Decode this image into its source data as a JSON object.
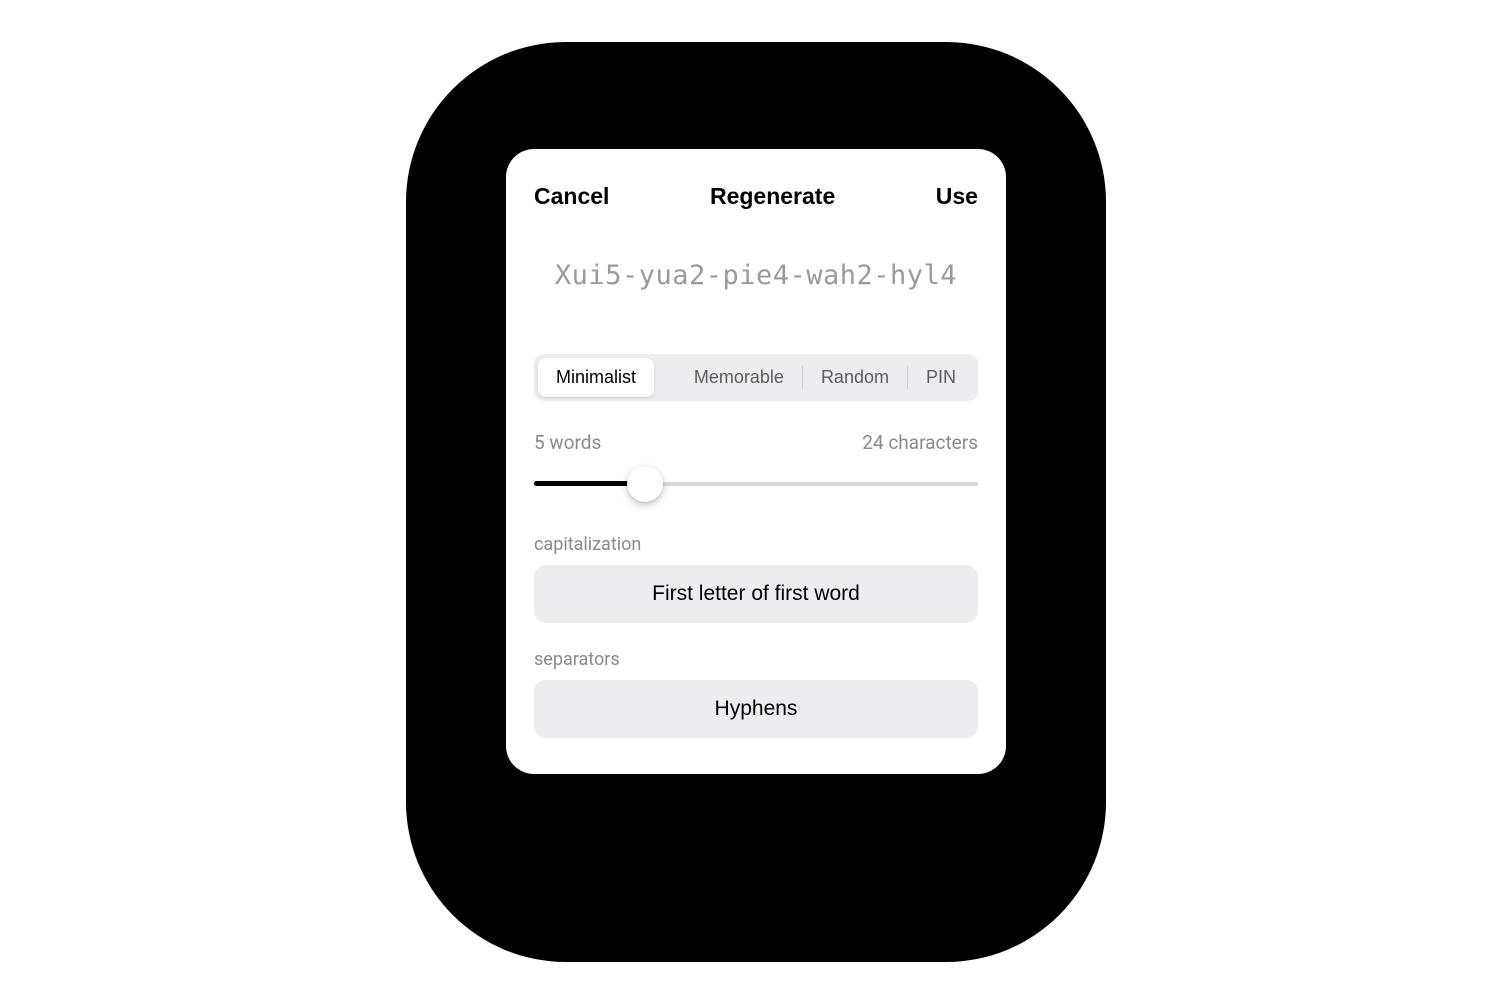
{
  "header": {
    "cancel": "Cancel",
    "regenerate": "Regenerate",
    "use": "Use"
  },
  "password": "Xui5-yua2-pie4-wah2-hyl4",
  "segments": {
    "minimalist": "Minimalist",
    "memorable": "Memorable",
    "random": "Random",
    "pin": "PIN",
    "active": "minimalist"
  },
  "slider": {
    "left_label": "5 words",
    "right_label": "24 characters",
    "percent": 25
  },
  "capitalization": {
    "label": "capitalization",
    "value": "First letter of first word"
  },
  "separators": {
    "label": "separators",
    "value": "Hyphens"
  }
}
